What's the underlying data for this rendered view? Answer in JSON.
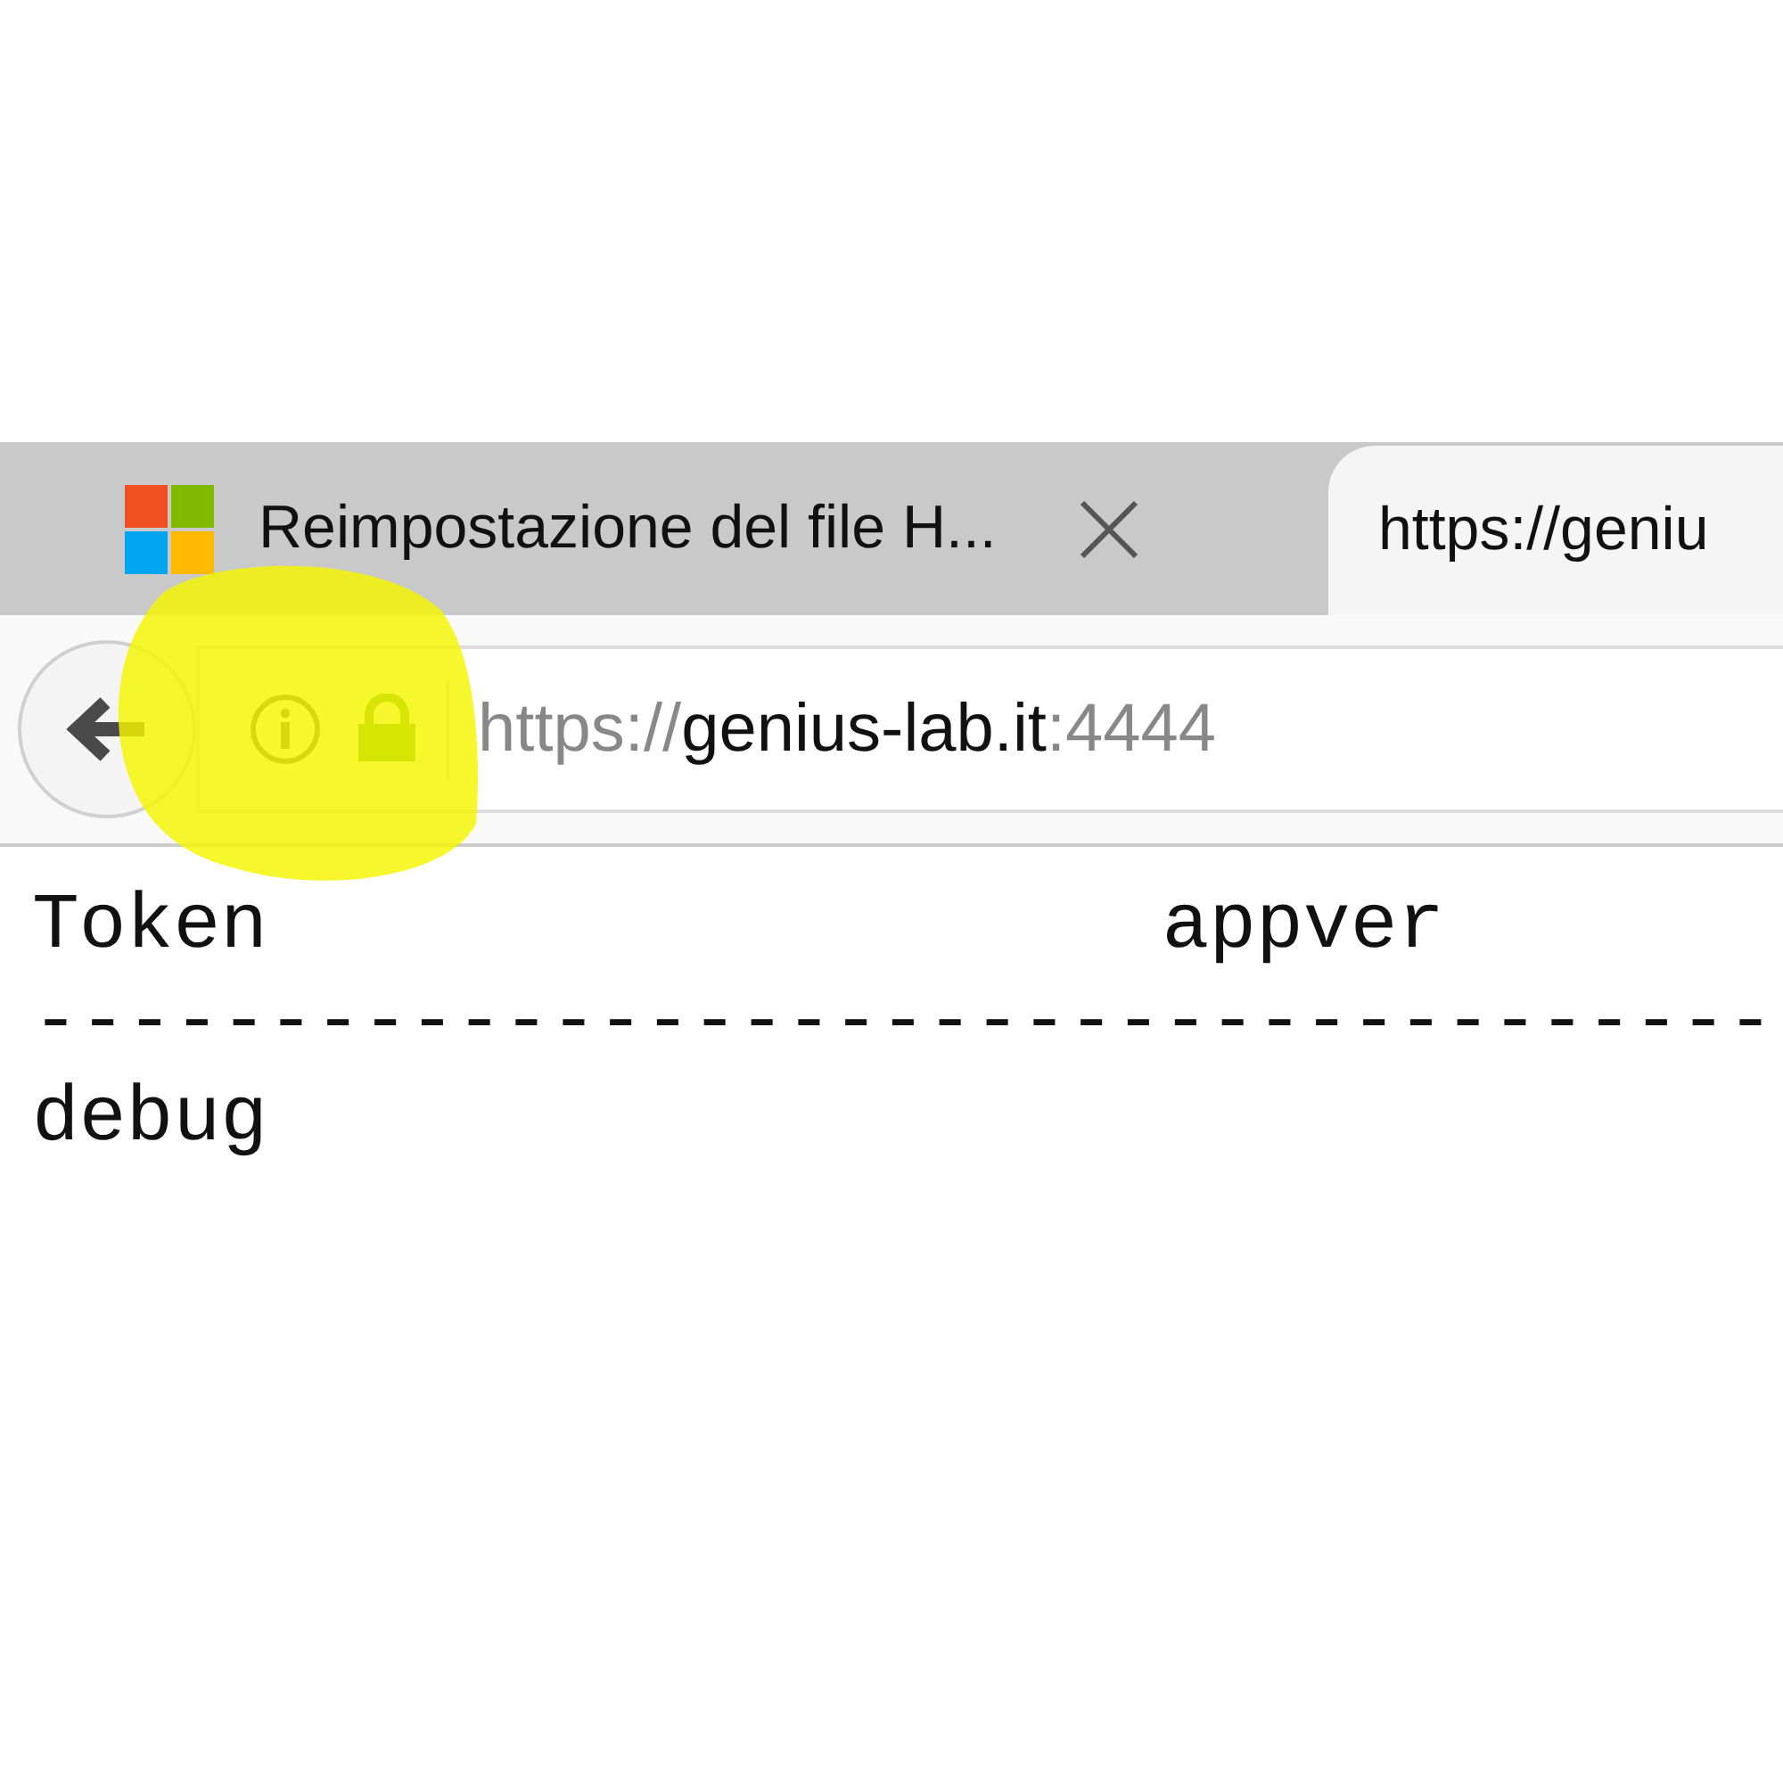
{
  "tabs": [
    {
      "title": "Reimpostazione del file H...",
      "selected": false,
      "kind": "with-logo",
      "closable": true
    },
    {
      "title": "https://geniu",
      "selected": true
    }
  ],
  "address_bar": {
    "scheme": "https://",
    "host": "genius-lab.it",
    "port": ":4444"
  },
  "annotations": [
    {
      "kind": "highlight"
    }
  ],
  "content": {
    "columns": [
      "Token",
      "appver"
    ],
    "separator": "-------------------------------------",
    "rows": [
      [
        "debug"
      ]
    ]
  }
}
